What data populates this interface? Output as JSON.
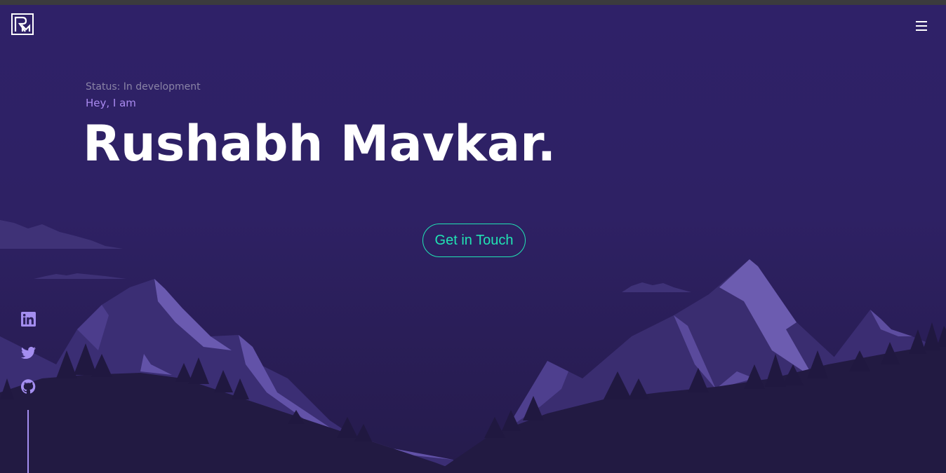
{
  "page": {
    "status": "Status: In development",
    "greeting": "Hey, I am",
    "name": "Rushabh Mavkar."
  },
  "header": {
    "logo_icon": "rm-monogram-logo",
    "menu_icon": "hamburger-menu-icon"
  },
  "cta": {
    "label": "Get in Touch"
  },
  "social": [
    {
      "icon": "linkedin-icon"
    },
    {
      "icon": "twitter-icon"
    },
    {
      "icon": "github-icon"
    }
  ],
  "colors": {
    "background": "#2f2165",
    "accent": "#21e3b4",
    "highlight": "#a98af0",
    "muted": "#8a84a6",
    "text": "#ffffff"
  }
}
